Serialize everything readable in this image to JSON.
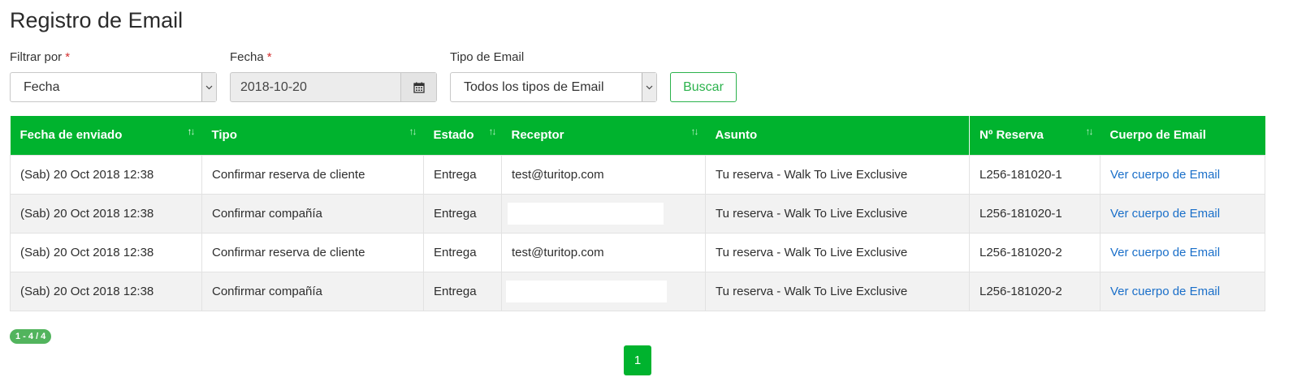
{
  "page": {
    "title": "Registro de Email"
  },
  "filters": {
    "filter_by": {
      "label": "Filtrar por",
      "required_mark": "*",
      "value": "Fecha"
    },
    "date": {
      "label": "Fecha",
      "required_mark": "*",
      "value": "2018-10-20"
    },
    "email_type": {
      "label": "Tipo de Email",
      "value": "Todos los tipos de Email"
    },
    "search_label": "Buscar"
  },
  "table": {
    "headers": [
      "Fecha de enviado",
      "Tipo",
      "Estado",
      "Receptor",
      "Asunto",
      "Nº Reserva",
      "Cuerpo de Email"
    ],
    "sort_glyph": "↑↓",
    "rows": [
      {
        "date": "(Sab) 20 Oct 2018 12:38",
        "type": "Confirmar reserva de cliente",
        "status": "Entrega",
        "receiver": "test@turitop.com",
        "subject": "Tu reserva - Walk To Live Exclusive",
        "booking": "L256-181020-1",
        "link": "Ver cuerpo de Email"
      },
      {
        "date": "(Sab) 20 Oct 2018 12:38",
        "type": "Confirmar compañía",
        "status": "Entrega",
        "receiver": "",
        "subject": "Tu reserva - Walk To Live Exclusive",
        "booking": "L256-181020-1",
        "link": "Ver cuerpo de Email"
      },
      {
        "date": "(Sab) 20 Oct 2018 12:38",
        "type": "Confirmar reserva de cliente",
        "status": "Entrega",
        "receiver": "test@turitop.com",
        "subject": "Tu reserva - Walk To Live Exclusive",
        "booking": "L256-181020-2",
        "link": "Ver cuerpo de Email"
      },
      {
        "date": "(Sab) 20 Oct 2018 12:38",
        "type": "Confirmar compañía",
        "status": "Entrega",
        "receiver": "",
        "subject": "Tu reserva - Walk To Live Exclusive",
        "booking": "L256-181020-2",
        "link": "Ver cuerpo de Email"
      }
    ]
  },
  "pagination": {
    "range_badge": "1 - 4 / 4",
    "current_page": "1"
  },
  "colors": {
    "accent": "#00b32e",
    "link": "#1a6fc9",
    "required": "#d32f2f"
  },
  "icons": {
    "calendar": "calendar-icon",
    "caret": "chevron-down-icon",
    "sort": "sort-icon"
  }
}
